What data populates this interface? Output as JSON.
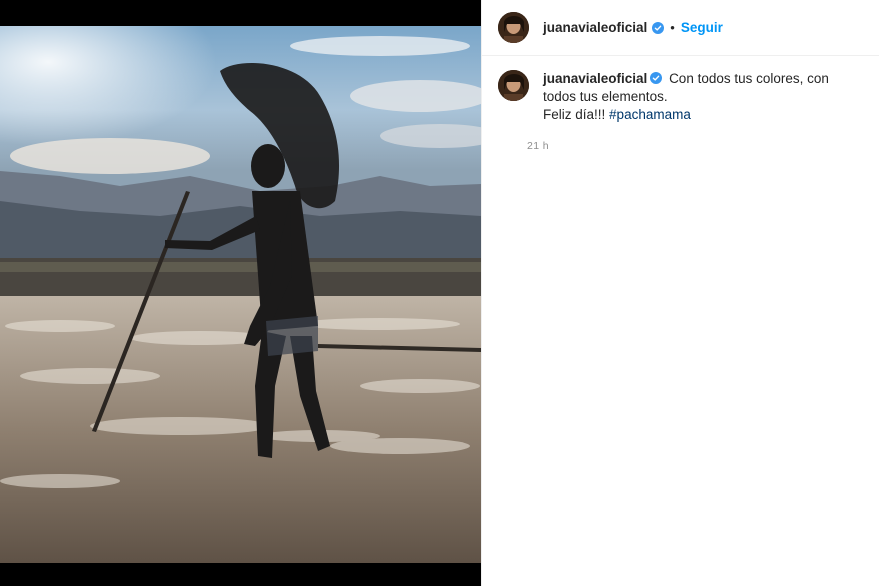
{
  "post": {
    "username": "juanavialeoficial",
    "follow_label": "Seguir",
    "separator": "•",
    "caption": {
      "text": "Con todos tus colores, con todos tus elementos.",
      "line2_text": "Feliz día!!!",
      "hashtag": "#pachamama"
    },
    "time_ago": "21 h"
  },
  "colors": {
    "link": "#0095f6",
    "hashtag": "#00376b",
    "verified": "#3897f0",
    "text": "#262626",
    "muted": "#8e8e8e"
  },
  "icons": {
    "verified": "verified-badge-icon"
  }
}
